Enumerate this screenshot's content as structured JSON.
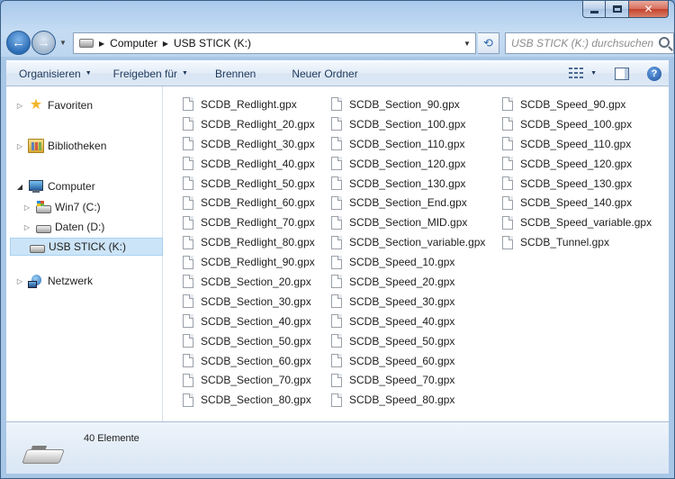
{
  "window": {
    "caption_buttons": [
      "minimize",
      "maximize",
      "close"
    ]
  },
  "address_bar": {
    "breadcrumbs": [
      "Computer",
      "USB STICK (K:)"
    ],
    "search_placeholder": "USB STICK (K:) durchsuchen"
  },
  "toolbar": {
    "organize": "Organisieren",
    "share": "Freigeben für",
    "burn": "Brennen",
    "new_folder": "Neuer Ordner"
  },
  "nav_pane": {
    "favorites": "Favoriten",
    "libraries": "Bibliotheken",
    "computer": "Computer",
    "drive_c": "Win7 (C:)",
    "drive_d": "Daten (D:)",
    "drive_k": "USB STICK (K:)",
    "network": "Netzwerk"
  },
  "files": {
    "col1": [
      "SCDB_Redlight.gpx",
      "SCDB_Redlight_20.gpx",
      "SCDB_Redlight_30.gpx",
      "SCDB_Redlight_40.gpx",
      "SCDB_Redlight_50.gpx",
      "SCDB_Redlight_60.gpx",
      "SCDB_Redlight_70.gpx",
      "SCDB_Redlight_80.gpx",
      "SCDB_Redlight_90.gpx",
      "SCDB_Section_20.gpx",
      "SCDB_Section_30.gpx",
      "SCDB_Section_40.gpx",
      "SCDB_Section_50.gpx",
      "SCDB_Section_60.gpx",
      "SCDB_Section_70.gpx",
      "SCDB_Section_80.gpx"
    ],
    "col2": [
      "SCDB_Section_90.gpx",
      "SCDB_Section_100.gpx",
      "SCDB_Section_110.gpx",
      "SCDB_Section_120.gpx",
      "SCDB_Section_130.gpx",
      "SCDB_Section_End.gpx",
      "SCDB_Section_MID.gpx",
      "SCDB_Section_variable.gpx",
      "SCDB_Speed_10.gpx",
      "SCDB_Speed_20.gpx",
      "SCDB_Speed_30.gpx",
      "SCDB_Speed_40.gpx",
      "SCDB_Speed_50.gpx",
      "SCDB_Speed_60.gpx",
      "SCDB_Speed_70.gpx",
      "SCDB_Speed_80.gpx"
    ],
    "col3": [
      "SCDB_Speed_90.gpx",
      "SCDB_Speed_100.gpx",
      "SCDB_Speed_110.gpx",
      "SCDB_Speed_120.gpx",
      "SCDB_Speed_130.gpx",
      "SCDB_Speed_140.gpx",
      "SCDB_Speed_variable.gpx",
      "SCDB_Tunnel.gpx"
    ]
  },
  "status": {
    "item_count": "40 Elemente"
  }
}
